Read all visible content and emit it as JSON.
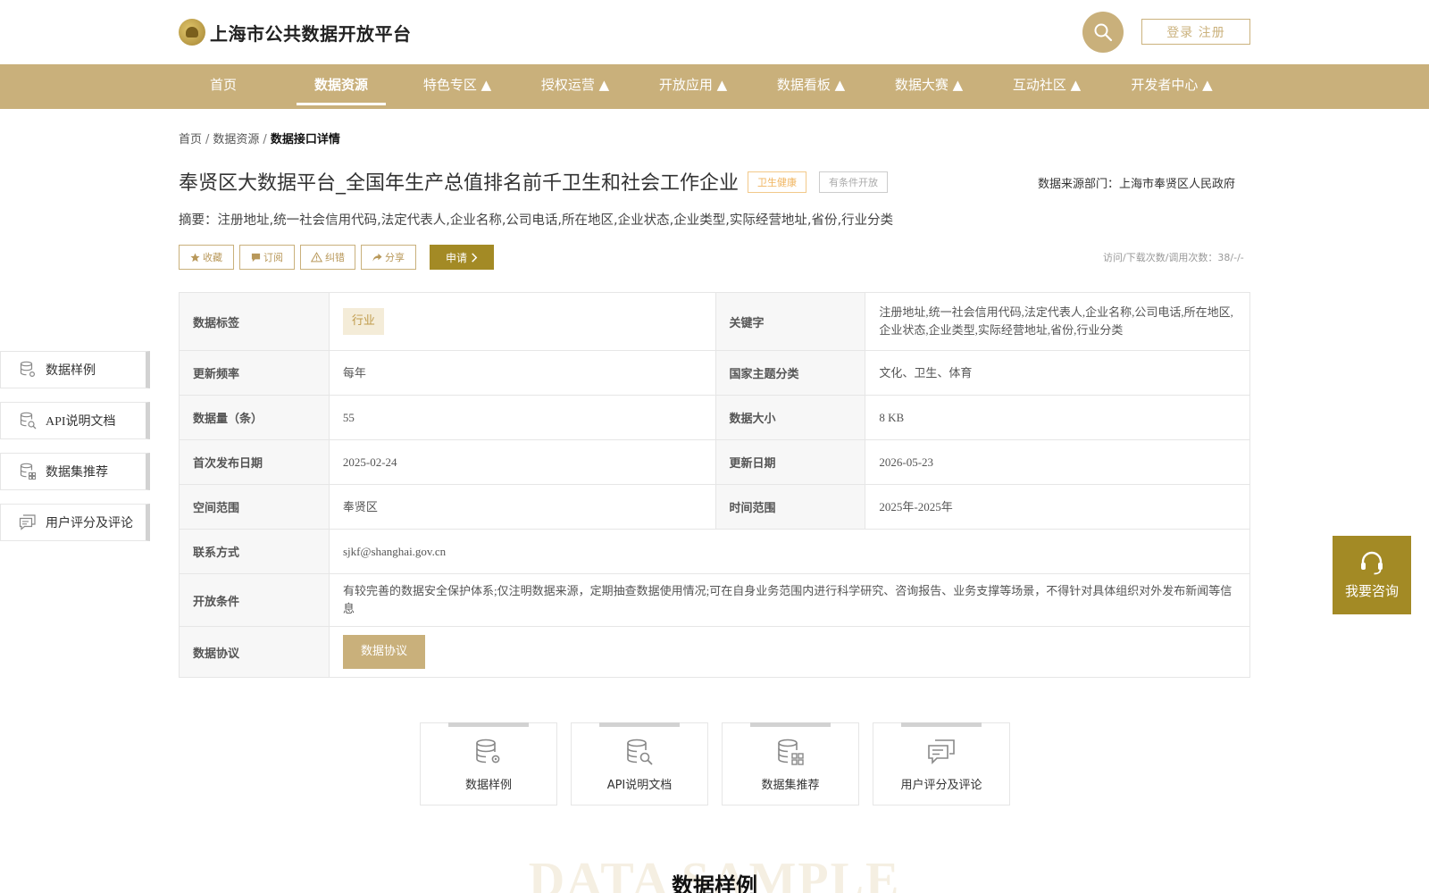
{
  "header": {
    "site_title": "上海市公共数据开放平台",
    "login_label": "登录 注册"
  },
  "nav": [
    {
      "label": "首页"
    },
    {
      "label": "数据资源"
    },
    {
      "label": "特色专区 ▲"
    },
    {
      "label": "授权运营 ▲"
    },
    {
      "label": "开放应用 ▲"
    },
    {
      "label": "数据看板 ▲"
    },
    {
      "label": "数据大赛 ▲"
    },
    {
      "label": "互动社区 ▲"
    },
    {
      "label": "开发者中心 ▲"
    }
  ],
  "breadcrumb": {
    "home": "首页",
    "sep": "/",
    "resources": "数据资源",
    "current": "数据接口详情"
  },
  "dataset": {
    "title": "奉贤区大数据平台_全国年生产总值排名前千卫生和社会工作企业",
    "tag_theme": "卫生健康",
    "tag_open": "有条件开放",
    "source": "数据来源部门：上海市奉贤区人民政府",
    "summary": "摘要：注册地址,统一社会信用代码,法定代表人,企业名称,公司电话,所在地区,企业状态,企业类型,实际经营地址,省份,行业分类",
    "stats": "访问/下载次数/调用次数：38/-/-"
  },
  "actions": {
    "favorite": "收藏",
    "subscribe": "订阅",
    "correct": "纠错",
    "share": "分享",
    "apply": "申请"
  },
  "side_nav": [
    {
      "label": "数据样例"
    },
    {
      "label": "API说明文档"
    },
    {
      "label": "数据集推荐"
    },
    {
      "label": "用户评分及评论"
    }
  ],
  "details": {
    "tag_key": "数据标签",
    "tag_value": "行业",
    "keywords_key": "关键字",
    "keywords_value": "注册地址,统一社会信用代码,法定代表人,企业名称,公司电话,所在地区,企业状态,企业类型,实际经营地址,省份,行业分类",
    "freq_key": "更新频率",
    "freq_value": "每年",
    "category_key": "国家主题分类",
    "category_value": "文化、卫生、体育",
    "count_key": "数据量（条）",
    "count_value": "55",
    "size_key": "数据大小",
    "size_value": "8 KB",
    "first_pub_key": "首次发布日期",
    "first_pub_value": "2025-02-24",
    "updated_key": "更新日期",
    "updated_value": "2026-05-23",
    "space_key": "空间范围",
    "space_value": "奉贤区",
    "time_key": "时间范围",
    "time_value": "2025年-2025年",
    "contact_key": "联系方式",
    "contact_value": "sjkf@shanghai.gov.cn",
    "condition_key": "开放条件",
    "condition_value": "有较完善的数据安全保护体系;仅注明数据来源，定期抽查数据使用情况;可在自身业务范围内进行科学研究、咨询报告、业务支撑等场景，不得针对具体组织对外发布新闻等信息",
    "protocol_key": "数据协议",
    "protocol_button": "数据协议"
  },
  "cards": [
    {
      "label": "数据样例"
    },
    {
      "label": "API说明文档"
    },
    {
      "label": "数据集推荐"
    },
    {
      "label": "用户评分及评论"
    }
  ],
  "section": {
    "bg_text": "DATA SAMPLE",
    "title": "数据样例"
  },
  "consult": {
    "label": "我要咨询"
  },
  "colors": {
    "brand": "#c9b07b",
    "brand_dark": "#a38a25"
  }
}
